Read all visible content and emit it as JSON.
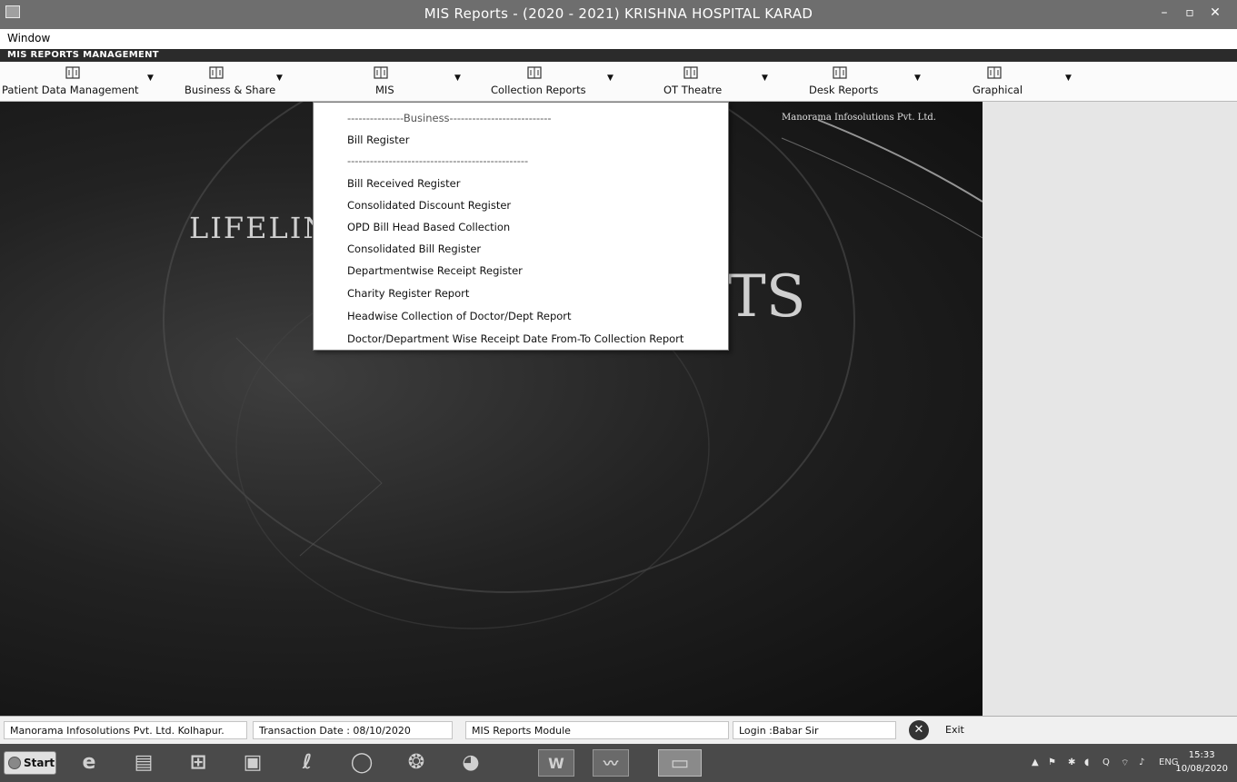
{
  "window": {
    "title": "MIS Reports - (2020 - 2021) KRISHNA HOSPITAL KARAD",
    "min_glyph": "–",
    "max_glyph": "▫",
    "close_glyph": "✕"
  },
  "menubar": {
    "window_label": "Window"
  },
  "header": {
    "title": "MIS REPORTS MANAGEMENT"
  },
  "toolbar": {
    "items": [
      {
        "label": "Patient Data Management"
      },
      {
        "label": "Business & Share"
      },
      {
        "label": "MIS"
      },
      {
        "label": "Collection Reports"
      },
      {
        "label": "OT Theatre"
      },
      {
        "label": "Desk Reports"
      },
      {
        "label": "Graphical"
      }
    ]
  },
  "splash": {
    "company": "Manorama Infosolutions Pvt. Ltd.",
    "text_left": "LIFELIN",
    "text_right": "TS"
  },
  "dropdown": {
    "items": [
      {
        "label": "---------------Business---------------------------",
        "separator": true
      },
      {
        "label": "Bill Register"
      },
      {
        "label": "------------------------------------------------",
        "separator": true
      },
      {
        "label": "Bill Received Register"
      },
      {
        "label": "Consolidated Discount Register"
      },
      {
        "label": "OPD Bill Head Based Collection"
      },
      {
        "label": "Consolidated Bill Register"
      },
      {
        "label": "Departmentwise Receipt Register"
      },
      {
        "label": "Charity Register Report"
      },
      {
        "label": "Headwise Collection of Doctor/Dept Report"
      },
      {
        "label": "Doctor/Department Wise Receipt Date From-To Collection Report"
      }
    ]
  },
  "statusbar": {
    "company": "Manorama Infosolutions Pvt. Ltd. Kolhapur.",
    "transaction": "Transaction Date : 08/10/2020",
    "module": "MIS Reports Module",
    "login": "Login :Babar Sir",
    "exit_label": "Exit"
  },
  "taskbar": {
    "start_label": "Start",
    "lang": "ENG",
    "time": "15:33",
    "date": "10/08/2020"
  }
}
